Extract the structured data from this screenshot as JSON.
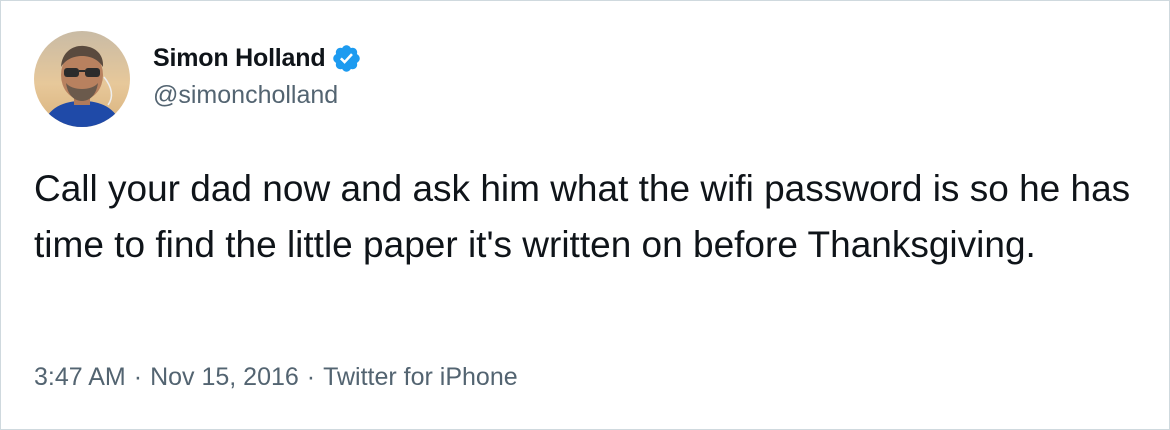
{
  "author": {
    "display_name": "Simon Holland",
    "handle": "@simoncholland",
    "verified": true,
    "avatar_icon": "profile-photo"
  },
  "tweet": {
    "text": "Call your dad now and ask him what the wifi password is so he has time to find the little paper it's written on before Thanksgiving."
  },
  "meta": {
    "time": "3:47 AM",
    "separator": "·",
    "date": "Nov 15, 2016",
    "source": "Twitter for iPhone"
  },
  "colors": {
    "text_primary": "#0f1419",
    "text_secondary": "#536471",
    "verified_badge": "#1d9bf0",
    "border": "#cfd9de"
  }
}
